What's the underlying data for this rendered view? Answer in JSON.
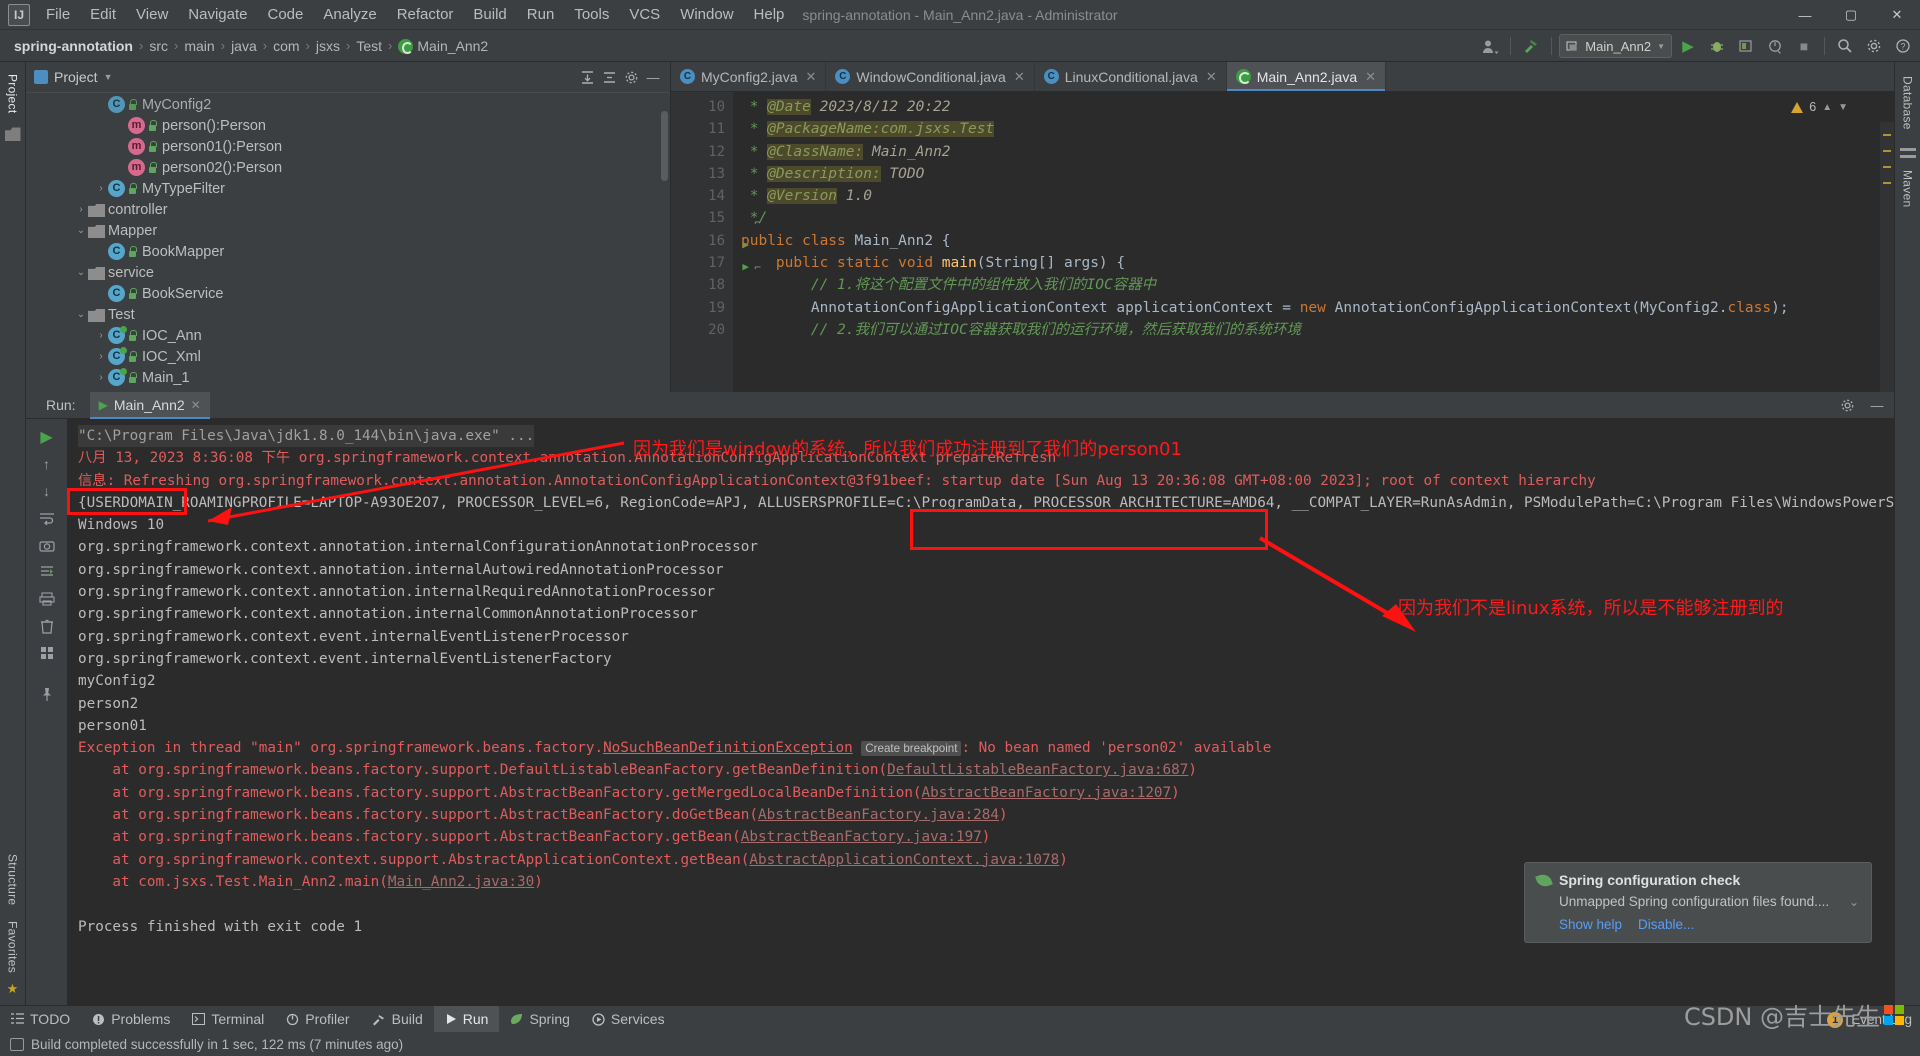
{
  "window": {
    "title": "spring-annotation - Main_Ann2.java - Administrator",
    "logo": "IJ",
    "minimize": "—",
    "maximize": "▢",
    "close": "✕"
  },
  "menu": [
    "File",
    "Edit",
    "View",
    "Navigate",
    "Code",
    "Analyze",
    "Refactor",
    "Build",
    "Run",
    "Tools",
    "VCS",
    "Window",
    "Help"
  ],
  "breadcrumbs": [
    "spring-annotation",
    "src",
    "main",
    "java",
    "com",
    "jsxs",
    "Test",
    "Main_Ann2"
  ],
  "toolbar": {
    "run_config": "Main_Ann2",
    "run_icon": "▶",
    "debug_icon": "🐞",
    "coverage_icon": "▣",
    "profile_icon": "⏱",
    "stop_icon": "■",
    "search_icon": "🔍",
    "settings_icon": "⚙",
    "avatar_icon": "👤",
    "build_icon": "🔨",
    "help_icon": "?"
  },
  "sidebar_left": {
    "top_label": "Project",
    "bottom_labels": [
      "Structure",
      "Favorites"
    ]
  },
  "sidebar_right": {
    "labels": [
      "Database",
      "Maven"
    ]
  },
  "project_panel": {
    "title": "Project",
    "icons": [
      "collapse-all-icon",
      "expand-icon",
      "settings-icon",
      "hide-icon"
    ],
    "tree": [
      {
        "indent": 3,
        "arrow": "",
        "icon": "class",
        "label": "MyConfig2",
        "dim": true
      },
      {
        "indent": 4,
        "arrow": "",
        "icon": "method",
        "label": "person():Person"
      },
      {
        "indent": 4,
        "arrow": "",
        "icon": "method",
        "label": "person01():Person"
      },
      {
        "indent": 4,
        "arrow": "",
        "icon": "method",
        "label": "person02():Person"
      },
      {
        "indent": 3,
        "arrow": "›",
        "icon": "class",
        "label": "MyTypeFilter"
      },
      {
        "indent": 2,
        "arrow": "›",
        "icon": "folder",
        "label": "controller"
      },
      {
        "indent": 2,
        "arrow": "⌄",
        "icon": "folder",
        "label": "Mapper"
      },
      {
        "indent": 3,
        "arrow": "",
        "icon": "class",
        "label": "BookMapper"
      },
      {
        "indent": 2,
        "arrow": "⌄",
        "icon": "folder",
        "label": "service"
      },
      {
        "indent": 3,
        "arrow": "",
        "icon": "class",
        "label": "BookService"
      },
      {
        "indent": 2,
        "arrow": "⌄",
        "icon": "folder",
        "label": "Test"
      },
      {
        "indent": 3,
        "arrow": "›",
        "icon": "class-run",
        "label": "IOC_Ann"
      },
      {
        "indent": 3,
        "arrow": "›",
        "icon": "class-run",
        "label": "IOC_Xml"
      },
      {
        "indent": 3,
        "arrow": "›",
        "icon": "class-run",
        "label": "Main_1"
      }
    ]
  },
  "editor": {
    "tabs": [
      {
        "label": "MyConfig2.java",
        "icon": "class-icon",
        "active": false
      },
      {
        "label": "WindowConditional.java",
        "icon": "class-icon",
        "active": false
      },
      {
        "label": "LinuxConditional.java",
        "icon": "class-icon",
        "active": false
      },
      {
        "label": "Main_Ann2.java",
        "icon": "spring-icon",
        "active": true
      }
    ],
    "warning_count": "6",
    "first_line_number": 10,
    "lines": [
      {
        "n": 10,
        "segs": [
          {
            "t": " * ",
            "c": "cmt"
          },
          {
            "t": "@Date",
            "c": "jd-tag"
          },
          {
            "t": " 2023/8/12 20:22",
            "c": "jd-val"
          }
        ]
      },
      {
        "n": 11,
        "segs": [
          {
            "t": " * ",
            "c": "cmt"
          },
          {
            "t": "@PackageName:com.jsxs.Test",
            "c": "jd-tag"
          }
        ]
      },
      {
        "n": 12,
        "segs": [
          {
            "t": " * ",
            "c": "cmt"
          },
          {
            "t": "@ClassName:",
            "c": "jd-tag"
          },
          {
            "t": " Main_Ann2",
            "c": "jd-val"
          }
        ]
      },
      {
        "n": 13,
        "segs": [
          {
            "t": " * ",
            "c": "cmt"
          },
          {
            "t": "@Description:",
            "c": "jd-tag"
          },
          {
            "t": " TODO",
            "c": "jd-val"
          }
        ]
      },
      {
        "n": 14,
        "segs": [
          {
            "t": " * ",
            "c": "cmt"
          },
          {
            "t": "@Version",
            "c": "jd-tag"
          },
          {
            "t": " 1.0",
            "c": "jd-val"
          }
        ]
      },
      {
        "n": 15,
        "segs": [
          {
            "t": " */",
            "c": "cmt"
          }
        ]
      },
      {
        "n": 16,
        "segs": [
          {
            "t": "public class ",
            "c": "kw"
          },
          {
            "t": "Main_Ann2 {",
            "c": "typ"
          }
        ],
        "runmark": true
      },
      {
        "n": 17,
        "segs": [
          {
            "t": "    public static void ",
            "c": "kw"
          },
          {
            "t": "main",
            "c": "fn"
          },
          {
            "t": "(String[] args) {",
            "c": "typ"
          }
        ],
        "runmark": true
      },
      {
        "n": 18,
        "segs": [
          {
            "t": "        // 1.将这个配置文件中的组件放入我们的IOC容器中",
            "c": "cmt"
          }
        ]
      },
      {
        "n": 19,
        "segs": [
          {
            "t": "        AnnotationConfigApplicationContext applicationContext = ",
            "c": "typ"
          },
          {
            "t": "new ",
            "c": "kw"
          },
          {
            "t": "AnnotationConfigApplicationContext(MyConfig2.",
            "c": "typ"
          },
          {
            "t": "class",
            "c": "kw"
          },
          {
            "t": ");",
            "c": "typ"
          }
        ]
      },
      {
        "n": 20,
        "segs": [
          {
            "t": "        // 2.我们可以通过IOC容器获取我们的运行环境，然后获取我们的系统环境",
            "c": "cmt"
          }
        ]
      }
    ]
  },
  "run_panel": {
    "label": "Run:",
    "tab_label": "Main_Ann2",
    "tab_icon": "▶",
    "close_icon": "✕",
    "settings_icon": "⚙",
    "hide_icon": "—",
    "side_icons": [
      "rerun-icon",
      "scroll-up-icon",
      "scroll-down-icon",
      "soft-wrap-icon",
      "camera-icon",
      "print-icon",
      "scroll-end-icon",
      "clear-all-icon",
      "grid-icon",
      "pin-icon"
    ],
    "console": [
      {
        "type": "cmd",
        "text": "\"C:\\Program Files\\Java\\jdk1.8.0_144\\bin\\java.exe\" ..."
      },
      {
        "type": "red",
        "text": "八月 13, 2023 8:36:08 下午 org.springframework.context.annotation.AnnotationConfigApplicationContext prepareRefresh"
      },
      {
        "type": "red",
        "text": "信息: Refreshing org.springframework.context.annotation.AnnotationConfigApplicationContext@3f91beef: startup date [Sun Aug 13 20:36:08 GMT+08:00 2023]; root of context hierarchy"
      },
      {
        "type": "plain",
        "text": "{USERDOMAIN_ROAMINGPROFILE=LAPTOP-A93OE2O7, PROCESSOR_LEVEL=6, RegionCode=APJ, ALLUSERSPROFILE=C:\\ProgramData, PROCESSOR_ARCHITECTURE=AMD64, __COMPAT_LAYER=RunAsAdmin, PSModulePath=C:\\Program Files\\WindowsPowerShell\\Modules;C:"
      },
      {
        "type": "plain",
        "text": "Windows 10"
      },
      {
        "type": "plain",
        "text": "org.springframework.context.annotation.internalConfigurationAnnotationProcessor"
      },
      {
        "type": "plain",
        "text": "org.springframework.context.annotation.internalAutowiredAnnotationProcessor"
      },
      {
        "type": "plain",
        "text": "org.springframework.context.annotation.internalRequiredAnnotationProcessor"
      },
      {
        "type": "plain",
        "text": "org.springframework.context.annotation.internalCommonAnnotationProcessor"
      },
      {
        "type": "plain",
        "text": "org.springframework.context.event.internalEventListenerProcessor"
      },
      {
        "type": "plain",
        "text": "org.springframework.context.event.internalEventListenerFactory"
      },
      {
        "type": "plain",
        "text": "myConfig2"
      },
      {
        "type": "plain",
        "text": "person2"
      },
      {
        "type": "plain",
        "text": "person01"
      },
      {
        "type": "exception",
        "text": "Exception in thread \"main\" org.springframework.beans.factory.",
        "link": "NoSuchBeanDefinitionException",
        "breakpoint": "Create breakpoint",
        "tail": ": No bean named 'person02' available"
      },
      {
        "type": "trace",
        "pre": "    at org.springframework.beans.factory.support.DefaultListableBeanFactory.getBeanDefinition(",
        "link": "DefaultListableBeanFactory.java:687",
        "post": ")"
      },
      {
        "type": "trace",
        "pre": "    at org.springframework.beans.factory.support.AbstractBeanFactory.getMergedLocalBeanDefinition(",
        "link": "AbstractBeanFactory.java:1207",
        "post": ")"
      },
      {
        "type": "trace",
        "pre": "    at org.springframework.beans.factory.support.AbstractBeanFactory.doGetBean(",
        "link": "AbstractBeanFactory.java:284",
        "post": ")"
      },
      {
        "type": "trace",
        "pre": "    at org.springframework.beans.factory.support.AbstractBeanFactory.getBean(",
        "link": "AbstractBeanFactory.java:197",
        "post": ")"
      },
      {
        "type": "trace",
        "pre": "    at org.springframework.context.support.AbstractApplicationContext.getBean(",
        "link": "AbstractApplicationContext.java:1078",
        "post": ")"
      },
      {
        "type": "trace",
        "pre": "    at com.jsxs.Test.Main_Ann2.main(",
        "link": "Main_Ann2.java:30",
        "post": ")"
      },
      {
        "type": "blank",
        "text": ""
      },
      {
        "type": "plain",
        "text": "Process finished with exit code 1"
      }
    ]
  },
  "annotations": {
    "note_top": "因为我们是window的系统，所以我们成功注册到了我们的person01",
    "note_bottom": "因为我们不是linux系统，所以是不能够注册到的",
    "color": "#ff1111"
  },
  "notification": {
    "title": "Spring configuration check",
    "subtitle": "Unmapped Spring configuration files found....",
    "links": [
      "Show help",
      "Disable..."
    ],
    "chevron": "⌄",
    "icon": "spring-leaf-icon"
  },
  "bottom_bar": {
    "items": [
      {
        "label": "TODO",
        "icon": "list-icon"
      },
      {
        "label": "Problems",
        "icon": "error-icon"
      },
      {
        "label": "Terminal",
        "icon": "terminal-icon"
      },
      {
        "label": "Profiler",
        "icon": "profiler-icon"
      },
      {
        "label": "Build",
        "icon": "hammer-icon"
      },
      {
        "label": "Run",
        "icon": "play-icon",
        "active": true
      },
      {
        "label": "Spring",
        "icon": "leaf-icon"
      },
      {
        "label": "Services",
        "icon": "services-icon"
      }
    ],
    "event_log": "Event Log",
    "event_count": "1"
  },
  "status_bar": {
    "message": "Build completed successfully in 1 sec, 122 ms (7 minutes ago)"
  },
  "watermark": {
    "text": "CSDN @吉士先生"
  }
}
